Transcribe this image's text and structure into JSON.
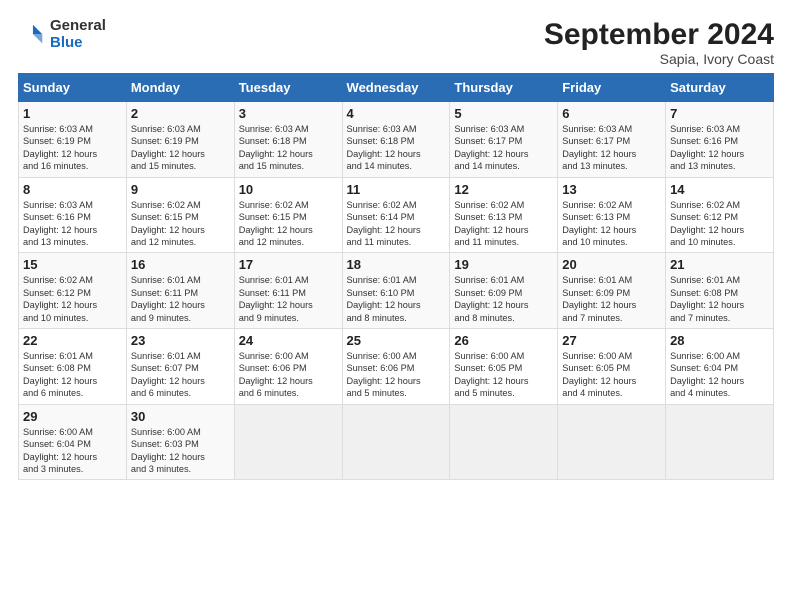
{
  "logo": {
    "general": "General",
    "blue": "Blue"
  },
  "title": "September 2024",
  "subtitle": "Sapia, Ivory Coast",
  "days_of_week": [
    "Sunday",
    "Monday",
    "Tuesday",
    "Wednesday",
    "Thursday",
    "Friday",
    "Saturday"
  ],
  "weeks": [
    [
      {
        "day": "1",
        "lines": [
          "Sunrise: 6:03 AM",
          "Sunset: 6:19 PM",
          "Daylight: 12 hours",
          "and 16 minutes."
        ]
      },
      {
        "day": "2",
        "lines": [
          "Sunrise: 6:03 AM",
          "Sunset: 6:19 PM",
          "Daylight: 12 hours",
          "and 15 minutes."
        ]
      },
      {
        "day": "3",
        "lines": [
          "Sunrise: 6:03 AM",
          "Sunset: 6:18 PM",
          "Daylight: 12 hours",
          "and 15 minutes."
        ]
      },
      {
        "day": "4",
        "lines": [
          "Sunrise: 6:03 AM",
          "Sunset: 6:18 PM",
          "Daylight: 12 hours",
          "and 14 minutes."
        ]
      },
      {
        "day": "5",
        "lines": [
          "Sunrise: 6:03 AM",
          "Sunset: 6:17 PM",
          "Daylight: 12 hours",
          "and 14 minutes."
        ]
      },
      {
        "day": "6",
        "lines": [
          "Sunrise: 6:03 AM",
          "Sunset: 6:17 PM",
          "Daylight: 12 hours",
          "and 13 minutes."
        ]
      },
      {
        "day": "7",
        "lines": [
          "Sunrise: 6:03 AM",
          "Sunset: 6:16 PM",
          "Daylight: 12 hours",
          "and 13 minutes."
        ]
      }
    ],
    [
      {
        "day": "8",
        "lines": [
          "Sunrise: 6:03 AM",
          "Sunset: 6:16 PM",
          "Daylight: 12 hours",
          "and 13 minutes."
        ]
      },
      {
        "day": "9",
        "lines": [
          "Sunrise: 6:02 AM",
          "Sunset: 6:15 PM",
          "Daylight: 12 hours",
          "and 12 minutes."
        ]
      },
      {
        "day": "10",
        "lines": [
          "Sunrise: 6:02 AM",
          "Sunset: 6:15 PM",
          "Daylight: 12 hours",
          "and 12 minutes."
        ]
      },
      {
        "day": "11",
        "lines": [
          "Sunrise: 6:02 AM",
          "Sunset: 6:14 PM",
          "Daylight: 12 hours",
          "and 11 minutes."
        ]
      },
      {
        "day": "12",
        "lines": [
          "Sunrise: 6:02 AM",
          "Sunset: 6:13 PM",
          "Daylight: 12 hours",
          "and 11 minutes."
        ]
      },
      {
        "day": "13",
        "lines": [
          "Sunrise: 6:02 AM",
          "Sunset: 6:13 PM",
          "Daylight: 12 hours",
          "and 10 minutes."
        ]
      },
      {
        "day": "14",
        "lines": [
          "Sunrise: 6:02 AM",
          "Sunset: 6:12 PM",
          "Daylight: 12 hours",
          "and 10 minutes."
        ]
      }
    ],
    [
      {
        "day": "15",
        "lines": [
          "Sunrise: 6:02 AM",
          "Sunset: 6:12 PM",
          "Daylight: 12 hours",
          "and 10 minutes."
        ]
      },
      {
        "day": "16",
        "lines": [
          "Sunrise: 6:01 AM",
          "Sunset: 6:11 PM",
          "Daylight: 12 hours",
          "and 9 minutes."
        ]
      },
      {
        "day": "17",
        "lines": [
          "Sunrise: 6:01 AM",
          "Sunset: 6:11 PM",
          "Daylight: 12 hours",
          "and 9 minutes."
        ]
      },
      {
        "day": "18",
        "lines": [
          "Sunrise: 6:01 AM",
          "Sunset: 6:10 PM",
          "Daylight: 12 hours",
          "and 8 minutes."
        ]
      },
      {
        "day": "19",
        "lines": [
          "Sunrise: 6:01 AM",
          "Sunset: 6:09 PM",
          "Daylight: 12 hours",
          "and 8 minutes."
        ]
      },
      {
        "day": "20",
        "lines": [
          "Sunrise: 6:01 AM",
          "Sunset: 6:09 PM",
          "Daylight: 12 hours",
          "and 7 minutes."
        ]
      },
      {
        "day": "21",
        "lines": [
          "Sunrise: 6:01 AM",
          "Sunset: 6:08 PM",
          "Daylight: 12 hours",
          "and 7 minutes."
        ]
      }
    ],
    [
      {
        "day": "22",
        "lines": [
          "Sunrise: 6:01 AM",
          "Sunset: 6:08 PM",
          "Daylight: 12 hours",
          "and 6 minutes."
        ]
      },
      {
        "day": "23",
        "lines": [
          "Sunrise: 6:01 AM",
          "Sunset: 6:07 PM",
          "Daylight: 12 hours",
          "and 6 minutes."
        ]
      },
      {
        "day": "24",
        "lines": [
          "Sunrise: 6:00 AM",
          "Sunset: 6:06 PM",
          "Daylight: 12 hours",
          "and 6 minutes."
        ]
      },
      {
        "day": "25",
        "lines": [
          "Sunrise: 6:00 AM",
          "Sunset: 6:06 PM",
          "Daylight: 12 hours",
          "and 5 minutes."
        ]
      },
      {
        "day": "26",
        "lines": [
          "Sunrise: 6:00 AM",
          "Sunset: 6:05 PM",
          "Daylight: 12 hours",
          "and 5 minutes."
        ]
      },
      {
        "day": "27",
        "lines": [
          "Sunrise: 6:00 AM",
          "Sunset: 6:05 PM",
          "Daylight: 12 hours",
          "and 4 minutes."
        ]
      },
      {
        "day": "28",
        "lines": [
          "Sunrise: 6:00 AM",
          "Sunset: 6:04 PM",
          "Daylight: 12 hours",
          "and 4 minutes."
        ]
      }
    ],
    [
      {
        "day": "29",
        "lines": [
          "Sunrise: 6:00 AM",
          "Sunset: 6:04 PM",
          "Daylight: 12 hours",
          "and 3 minutes."
        ]
      },
      {
        "day": "30",
        "lines": [
          "Sunrise: 6:00 AM",
          "Sunset: 6:03 PM",
          "Daylight: 12 hours",
          "and 3 minutes."
        ]
      },
      null,
      null,
      null,
      null,
      null
    ]
  ]
}
